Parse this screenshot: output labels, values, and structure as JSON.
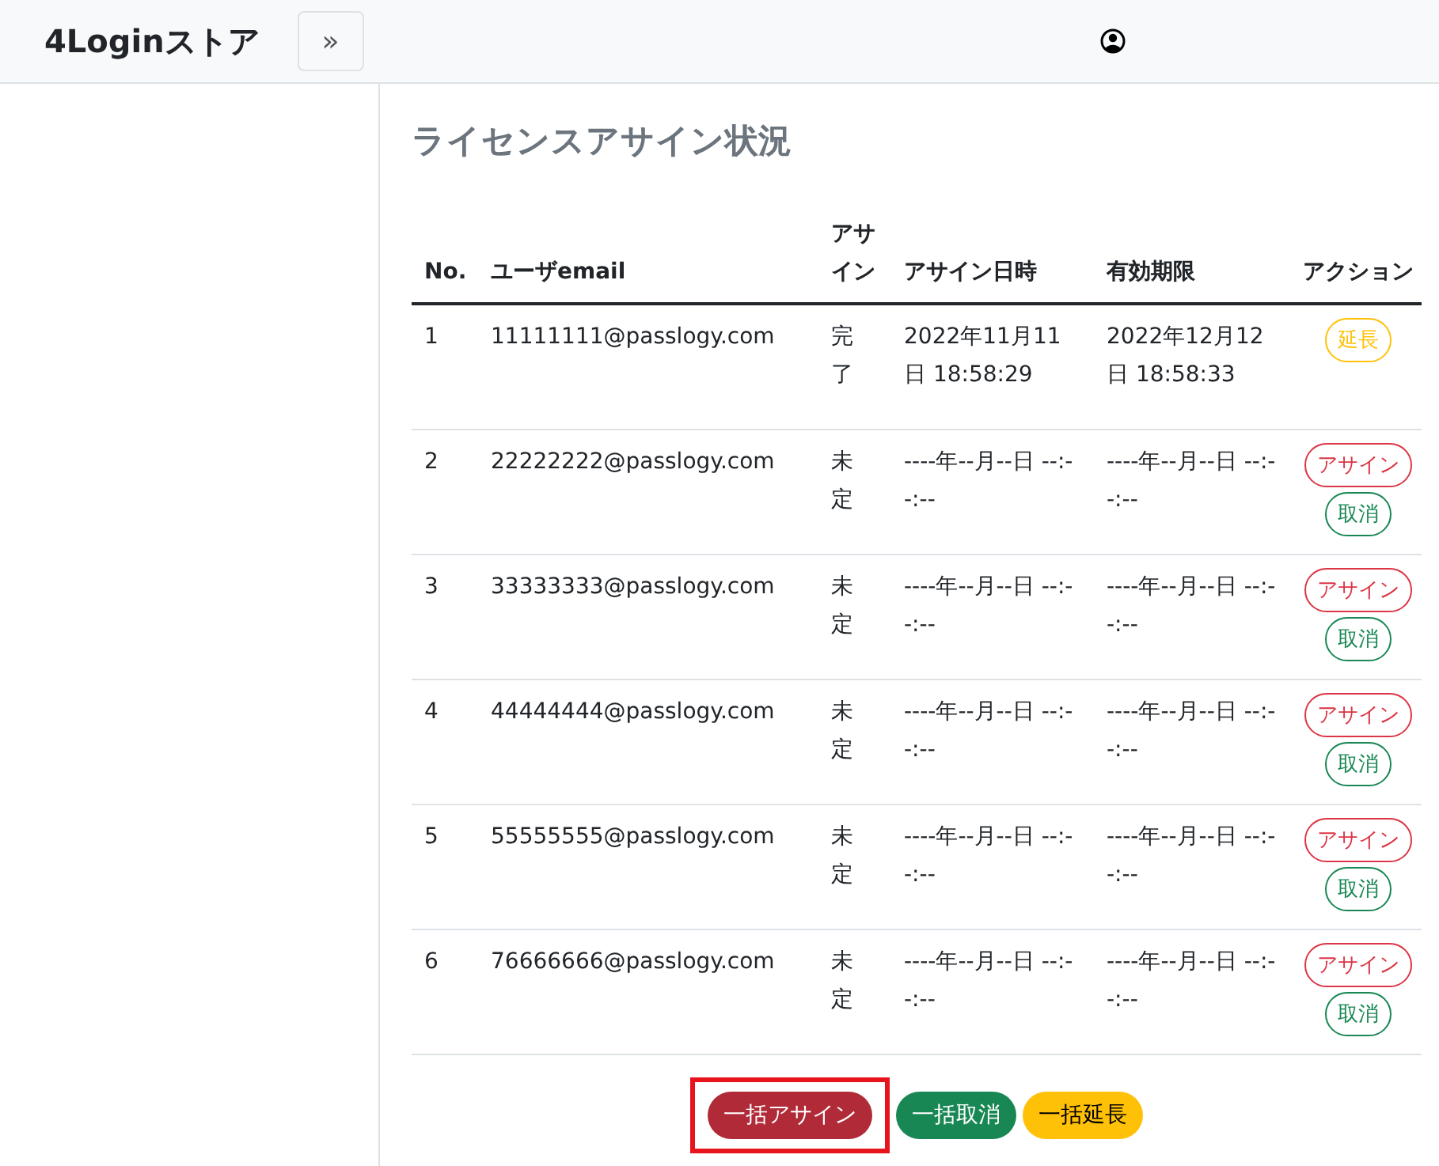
{
  "brand": "4Loginストア",
  "sidebar_toggle": "»",
  "title": "ライセンスアサイン状況",
  "columns": [
    "No.",
    "ユーザemail",
    "アサイン",
    "アサイン日時",
    "有効期限",
    "アクション"
  ],
  "rows": [
    {
      "no": "1",
      "email": "11111111@passlogy.com",
      "status": "完了",
      "assigned_at": "2022年11月11日 18:58:29",
      "expires": "2022年12月12日 18:58:33",
      "actions": [
        {
          "kind": "extend",
          "label": "延長"
        }
      ]
    },
    {
      "no": "2",
      "email": "22222222@passlogy.com",
      "status": "未定",
      "assigned_at": "----年--月--日 --:--:--",
      "expires": "----年--月--日 --:--:--",
      "actions": [
        {
          "kind": "assign",
          "label": "アサイン"
        },
        {
          "kind": "cancel",
          "label": "取消"
        }
      ]
    },
    {
      "no": "3",
      "email": "33333333@passlogy.com",
      "status": "未定",
      "assigned_at": "----年--月--日 --:--:--",
      "expires": "----年--月--日 --:--:--",
      "actions": [
        {
          "kind": "assign",
          "label": "アサイン"
        },
        {
          "kind": "cancel",
          "label": "取消"
        }
      ]
    },
    {
      "no": "4",
      "email": "44444444@passlogy.com",
      "status": "未定",
      "assigned_at": "----年--月--日 --:--:--",
      "expires": "----年--月--日 --:--:--",
      "actions": [
        {
          "kind": "assign",
          "label": "アサイン"
        },
        {
          "kind": "cancel",
          "label": "取消"
        }
      ]
    },
    {
      "no": "5",
      "email": "55555555@passlogy.com",
      "status": "未定",
      "assigned_at": "----年--月--日 --:--:--",
      "expires": "----年--月--日 --:--:--",
      "actions": [
        {
          "kind": "assign",
          "label": "アサイン"
        },
        {
          "kind": "cancel",
          "label": "取消"
        }
      ]
    },
    {
      "no": "6",
      "email": "76666666@passlogy.com",
      "status": "未定",
      "assigned_at": "----年--月--日 --:--:--",
      "expires": "----年--月--日 --:--:--",
      "actions": [
        {
          "kind": "assign",
          "label": "アサイン"
        },
        {
          "kind": "cancel",
          "label": "取消"
        }
      ]
    }
  ],
  "bulk_actions": [
    {
      "kind": "assign",
      "label": "一括アサイン",
      "highlighted": true
    },
    {
      "kind": "cancel",
      "label": "一括取消",
      "highlighted": false
    },
    {
      "kind": "extend",
      "label": "一括延長",
      "highlighted": false
    }
  ]
}
